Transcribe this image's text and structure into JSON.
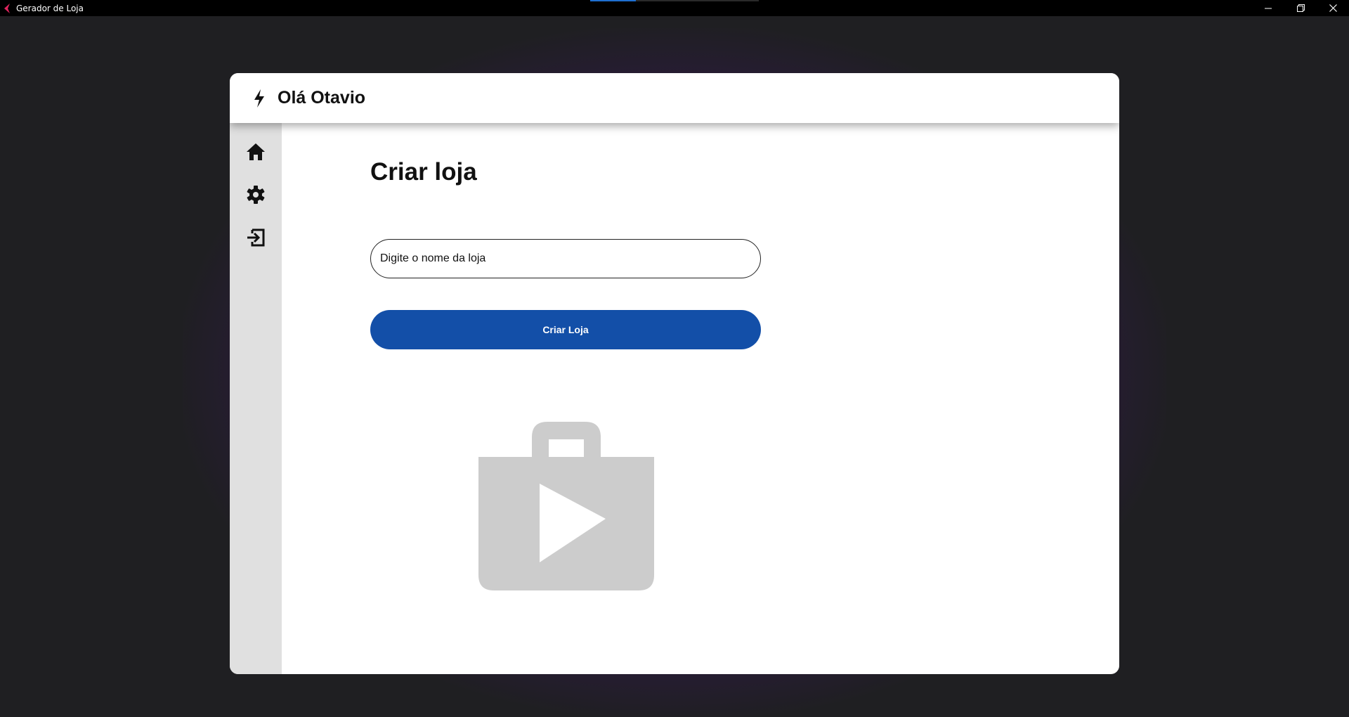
{
  "window": {
    "title": "Gerador de Loja",
    "progress": 0.27
  },
  "header": {
    "greeting": "Olá Otavio"
  },
  "sidebar": {
    "items": [
      {
        "icon": "home-icon"
      },
      {
        "icon": "gear-icon"
      },
      {
        "icon": "logout-icon"
      }
    ]
  },
  "main": {
    "title": "Criar loja",
    "store_name_placeholder": "Digite o nome da loja",
    "store_name_value": "",
    "create_button_label": "Criar Loja",
    "illustration_icon": "shop-bag-play-icon"
  },
  "colors": {
    "accent": "#134fa8",
    "sidebar_bg": "#e0e0e0",
    "illustration": "#cccccc",
    "glow": "#46147a"
  }
}
